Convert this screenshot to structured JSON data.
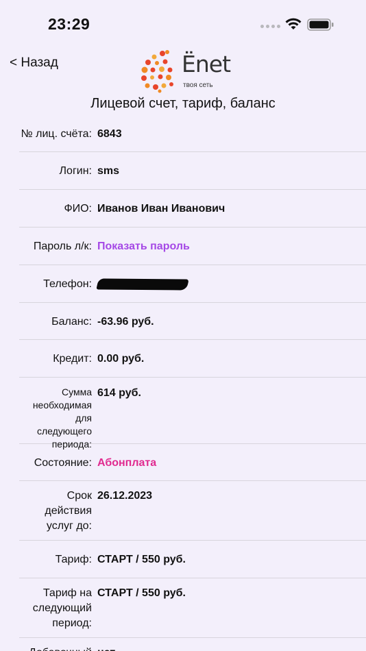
{
  "status_bar": {
    "time": "23:29"
  },
  "nav": {
    "back_label": "< Назад"
  },
  "logo": {
    "name": "Ёnet",
    "tagline": "твоя сеть"
  },
  "page": {
    "title": "Лицевой счет, тариф, баланс"
  },
  "rows": [
    {
      "label": "№ лиц. счёта:",
      "value": "6843"
    },
    {
      "label": "Логин:",
      "value": "sms"
    },
    {
      "label": "ФИО:",
      "value": "Иванов Иван Иванович"
    },
    {
      "label": "Пароль л/к:",
      "value": "Показать пароль"
    },
    {
      "label": "Телефон:",
      "value": ""
    },
    {
      "label": "Баланс:",
      "value": "-63.96 руб."
    },
    {
      "label": "Кредит:",
      "value": "0.00 руб."
    },
    {
      "label": "Сумма необходимая для следующего периода:",
      "value": "614 руб."
    },
    {
      "label": "Состояние:",
      "value": "Абонплата"
    },
    {
      "label": "Срок действия услуг до:",
      "value": "26.12.2023"
    },
    {
      "label": "Тариф:",
      "value": "СТАРТ / 550 руб."
    },
    {
      "label": "Тариф на следующий период:",
      "value": "СТАРТ / 550 руб."
    },
    {
      "label": "Добавочный",
      "value": "нет"
    }
  ]
}
